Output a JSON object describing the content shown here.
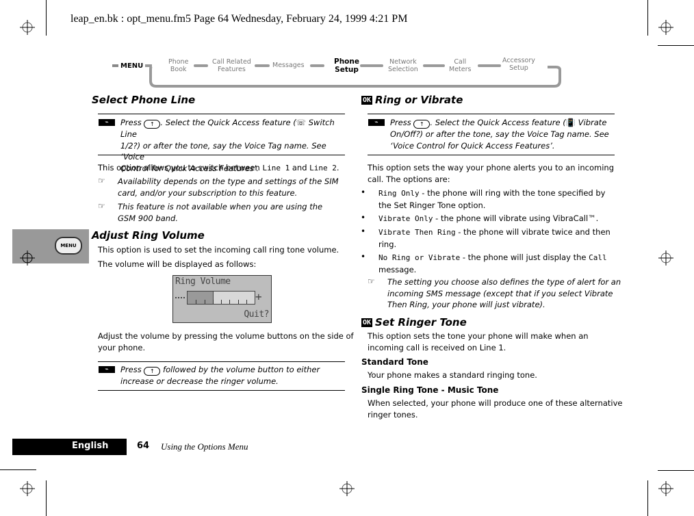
{
  "print_header": "leap_en.bk : opt_menu.fm5  Page 64  Wednesday, February 24, 1999  4:21 PM",
  "menu_nav": {
    "root": "MENU",
    "items": [
      {
        "line1": "Phone",
        "line2": "Book",
        "active": false
      },
      {
        "line1": "Call Related",
        "line2": "Features",
        "active": false
      },
      {
        "line1": "Messages",
        "line2": "",
        "active": false
      },
      {
        "line1": "Phone",
        "line2": "Setup",
        "active": true
      },
      {
        "line1": "Network",
        "line2": "Selection",
        "active": false
      },
      {
        "line1": "Call",
        "line2": "Meters",
        "active": false
      },
      {
        "line1": "Accessory",
        "line2": "Setup",
        "active": false
      }
    ]
  },
  "side_tab": {
    "label": "MENU"
  },
  "left": {
    "select_phone_line": {
      "title": "Select Phone Line",
      "tip": {
        "icon": "shortcut-icon",
        "text_1": "Press",
        "key": "↑",
        "text_2": ". Select the Quick Access feature (",
        "feature": " Switch Line",
        "text_3": "1/2?) or after the tone, say the Voice Tag name. See ‘Voice",
        "text_4": "Control for Quick Access Features’."
      },
      "body_pre": "This option allows you to switch between ",
      "line1": "Line 1",
      "body_and": " and ",
      "line2": "Line 2",
      "body_end": ".",
      "notes": [
        {
          "l1": "Availability depends on the type and settings of the SIM",
          "l2": "card, and/or your subscription to this feature."
        },
        {
          "l1": "This feature is not available when you are using the",
          "l2": "GSM 900 band."
        }
      ]
    },
    "adjust_ring_volume": {
      "title": "Adjust Ring Volume",
      "body_1": "This option is used to set the incoming call ring tone volume.",
      "body_2": "The volume will be displayed as follows:",
      "lcd": {
        "title": "Ring Volume",
        "softkey": "Quit?",
        "level": 3,
        "max_level": 8
      },
      "body_3a": "Adjust the volume by pressing the volume buttons on the side of",
      "body_3b": "your phone.",
      "tip": {
        "text_1": "Press",
        "key": "↑",
        "text_2": " followed by the volume button to either",
        "text_3": "increase or decrease the ringer volume."
      }
    }
  },
  "right": {
    "ring_or_vibrate": {
      "badge": "OK",
      "title": "Ring or Vibrate",
      "tip": {
        "text_1": "Press",
        "key": "↑",
        "text_2": ". Select the Quick Access feature (",
        "feature": " Vibrate",
        "text_3": "On/Off?) or after the tone, say the Voice Tag name. See",
        "text_4": "‘Voice Control for Quick Access Features’."
      },
      "body_1": "This option sets the way your phone alerts you to an incoming",
      "body_2": "call. The options are:",
      "options": [
        {
          "name": "Ring Only",
          "desc_1": " - the phone will ring with the tone specified by",
          "desc_2": "the Set Ringer Tone option."
        },
        {
          "name": "Vibrate Only",
          "desc_1": " - the phone will vibrate using VibraCall™.",
          "desc_2": ""
        },
        {
          "name": "Vibrate Then Ring",
          "desc_1": " - the phone will vibrate twice and then",
          "desc_2": "ring."
        },
        {
          "name": "No Ring or Vibrate",
          "desc_1": " - the phone will just display the ",
          "desc_mono": "Call",
          "desc_2": "message."
        }
      ],
      "note": {
        "l1": "The setting you choose also defines the type of alert for an",
        "l2": "incoming SMS message (except that if you select Vibrate",
        "l3": "Then Ring, your phone will just vibrate)."
      }
    },
    "set_ringer_tone": {
      "badge": "OK",
      "title": "Set Ringer Tone",
      "body_1": "This option sets the tone your phone will make when an",
      "body_2": "incoming call is received on Line 1.",
      "standard": {
        "heading": "Standard Tone",
        "text": "Your phone makes a standard ringing tone."
      },
      "single": {
        "heading": "Single Ring Tone - Music Tone",
        "text_1": "When selected, your phone will produce one of these alternative",
        "text_2": "ringer tones."
      }
    }
  },
  "footer": {
    "language": "English",
    "page_number": "64",
    "chapter": "Using the Options Menu"
  }
}
